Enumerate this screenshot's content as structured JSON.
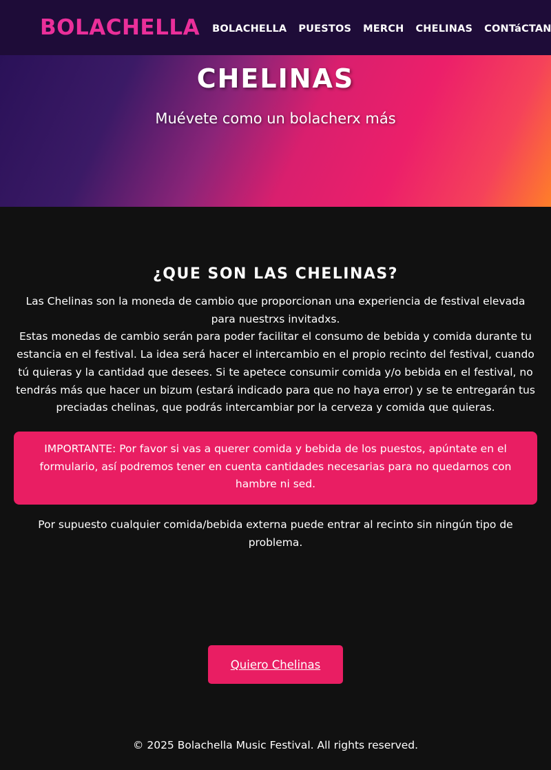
{
  "colors": {
    "accent": "#e91e63",
    "brand": "#ea2f9a",
    "nav_background": "#1e0c38",
    "page_background": "#111111"
  },
  "nav": {
    "brand": "BOLACHELLA",
    "links": [
      "BOLACHELLA",
      "PUESTOS",
      "MERCH",
      "CHELINAS",
      "CONTáCTANOS"
    ]
  },
  "hero": {
    "title": "CHELINAS",
    "subtitle": "Muévete como un bolacherx más"
  },
  "section": {
    "title": "¿QUE SON LAS CHELINAS?",
    "paragraph_1": "Las Chelinas son la moneda de cambio que proporcionan una experiencia de festival elevada para nuestrxs invitadxs.",
    "paragraph_2": "Estas monedas de cambio serán para poder facilitar el consumo de bebida y comida durante tu estancia en el festival. La idea será hacer el intercambio en el propio recinto del festival, cuando tú quieras y la cantidad que desees. Si te apetece consumir comida y/o bebida en el festival, no tendrás más que hacer un bizum (estará indicado para que no haya error) y se te entregarán tus preciadas chelinas, que podrás intercambiar por la cerveza y comida que quieras.",
    "alert": "IMPORTANTE: Por favor si vas a querer comida y bebida de los puestos, apúntate en el formulario, así podremos tener en cuenta cantidades necesarias para no quedarnos con hambre ni sed.",
    "note": "Por supuesto cualquier comida/bebida externa puede entrar al recinto sin ningún tipo de problema."
  },
  "cta": {
    "label": "Quiero Chelinas"
  },
  "footer": {
    "text": "© 2025 Bolachella Music Festival. All rights reserved."
  }
}
